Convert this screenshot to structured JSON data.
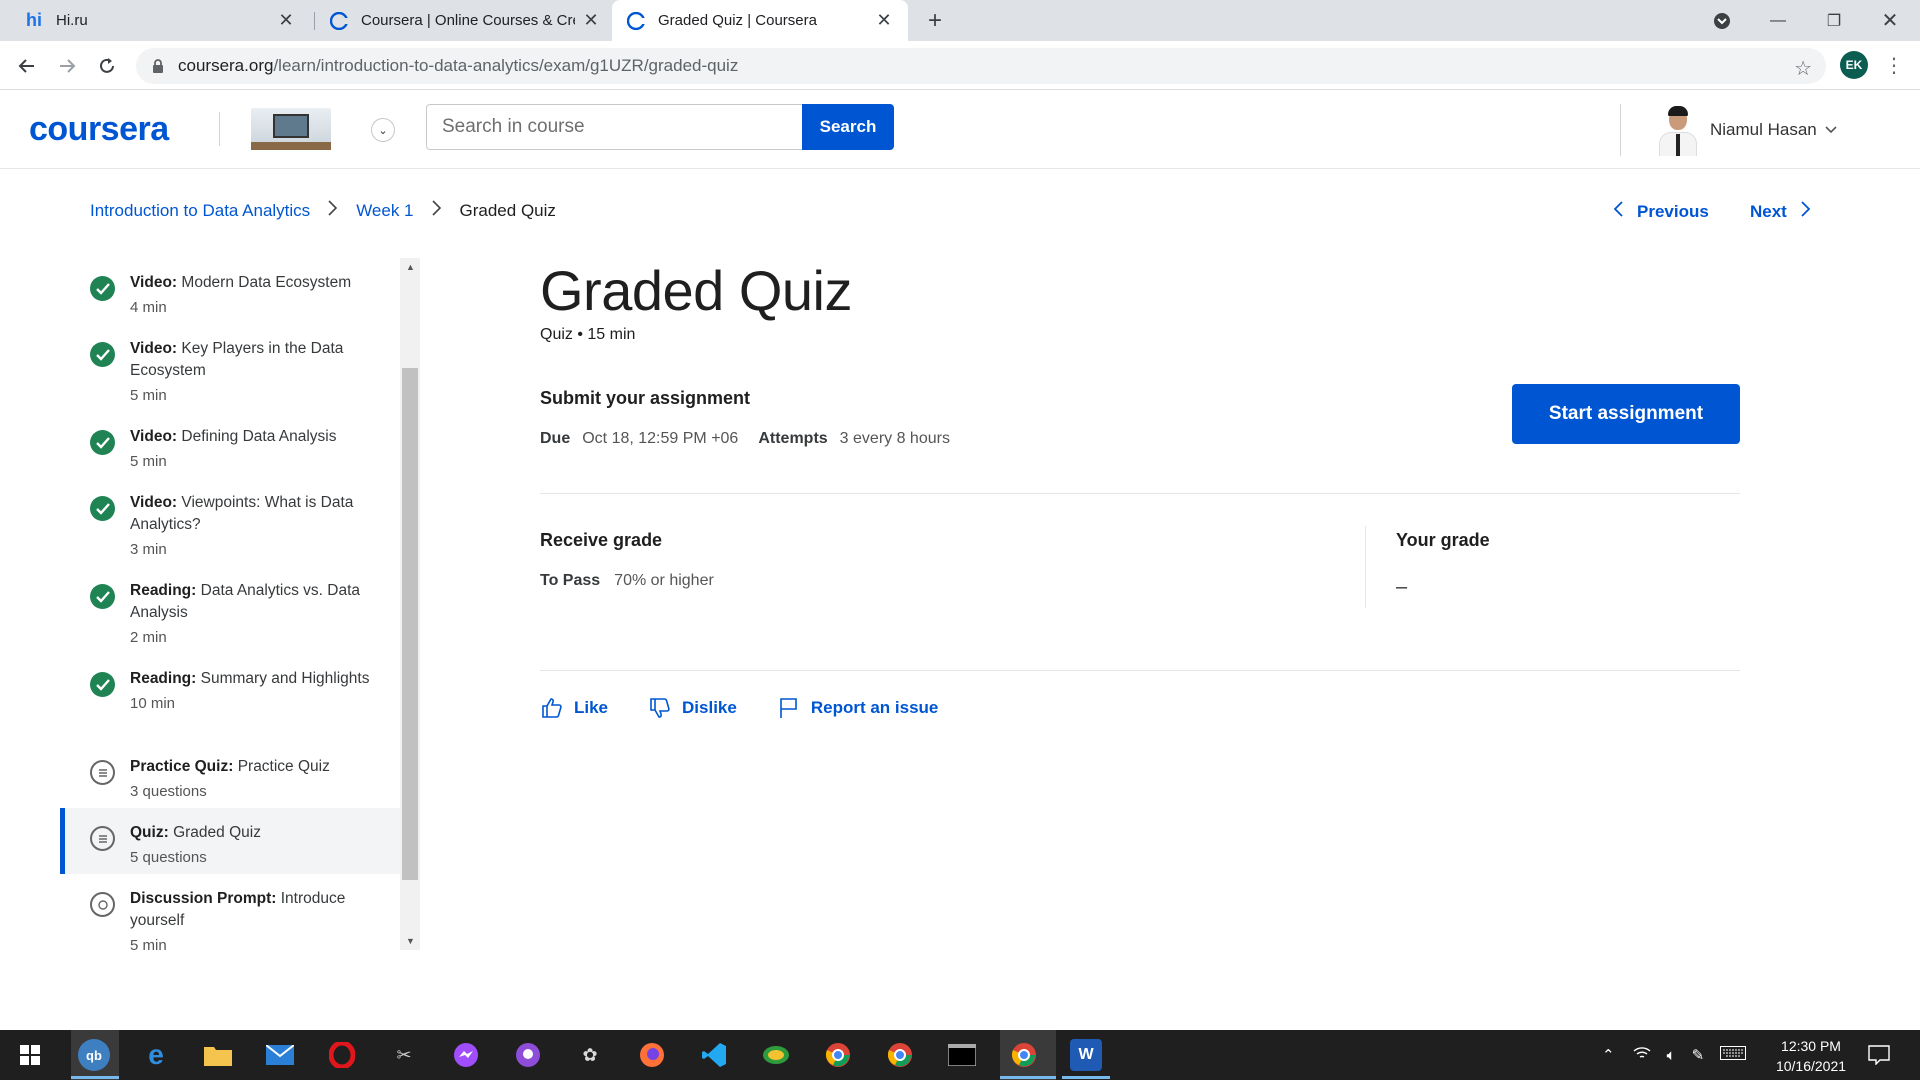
{
  "browser": {
    "tabs": [
      {
        "title": "Hi.ru",
        "favicon": "hi-favicon"
      },
      {
        "title": "Coursera | Online Courses & Crec",
        "favicon": "coursera-favicon"
      },
      {
        "title": "Graded Quiz | Coursera",
        "favicon": "coursera-favicon",
        "active": true
      }
    ],
    "url_host": "coursera.org",
    "url_path": "/learn/introduction-to-data-analytics/exam/g1UZR/graded-quiz",
    "profile_initials": "EK"
  },
  "header": {
    "logo": "coursera",
    "search_placeholder": "Search in course",
    "search_button": "Search",
    "user_name": "Niamul Hasan"
  },
  "breadcrumb": {
    "course": "Introduction to Data Analytics",
    "week": "Week 1",
    "current": "Graded Quiz"
  },
  "pager": {
    "previous": "Previous",
    "next": "Next"
  },
  "sidebar": {
    "items": [
      {
        "type": "Video:",
        "title": "Modern Data Ecosystem",
        "meta": "4 min",
        "status": "done"
      },
      {
        "type": "Video:",
        "title": "Key Players in the Data Ecosystem",
        "meta": "5 min",
        "status": "done"
      },
      {
        "type": "Video:",
        "title": "Defining Data Analysis",
        "meta": "5 min",
        "status": "done"
      },
      {
        "type": "Video:",
        "title": "Viewpoints: What is Data Analytics?",
        "meta": "3 min",
        "status": "done"
      },
      {
        "type": "Reading:",
        "title": "Data Analytics vs. Data Analysis",
        "meta": "2 min",
        "status": "done"
      },
      {
        "type": "Reading:",
        "title": "Summary and Highlights",
        "meta": "10 min",
        "status": "done"
      },
      {
        "type": "Practice Quiz:",
        "title": "Practice Quiz",
        "meta": "3 questions",
        "status": "quiz"
      },
      {
        "type": "Quiz:",
        "title": "Graded Quiz",
        "meta": "5 questions",
        "status": "quiz",
        "active": true
      },
      {
        "type": "Discussion Prompt:",
        "title": "Introduce yourself",
        "meta": "5 min",
        "status": "discussion"
      }
    ]
  },
  "main": {
    "title": "Graded Quiz",
    "meta": "Quiz • 15 min",
    "submit_title": "Submit your assignment",
    "due_label": "Due",
    "due_value": "Oct 18, 12:59 PM +06",
    "attempts_label": "Attempts",
    "attempts_value": "3 every 8 hours",
    "start_button": "Start assignment",
    "receive_title": "Receive grade",
    "pass_label": "To Pass",
    "pass_value": "70% or higher",
    "your_grade_title": "Your grade",
    "your_grade_value": "–",
    "like": "Like",
    "dislike": "Dislike",
    "report": "Report an issue"
  },
  "taskbar": {
    "time": "12:30 PM",
    "date": "10/16/2021"
  },
  "colors": {
    "accent": "#0056d2",
    "success": "#1f8354"
  }
}
